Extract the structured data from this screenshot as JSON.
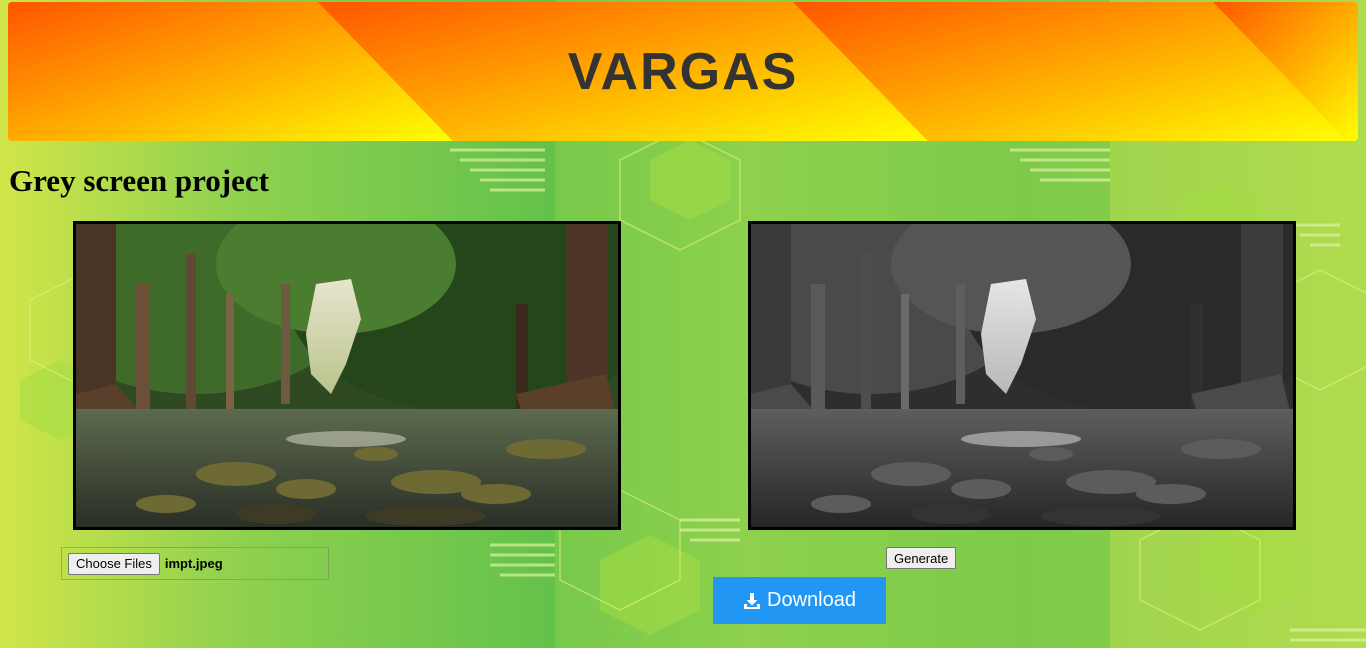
{
  "banner": {
    "title": "VARGAS",
    "colors": {
      "orange": "#ff5500",
      "yellow": "#ffff00"
    }
  },
  "page": {
    "title": "Grey screen project"
  },
  "images": {
    "original": {
      "alt": "",
      "kind": "color-forest-river"
    },
    "grey": {
      "alt": "",
      "kind": "greyscale-forest-river"
    }
  },
  "file_input": {
    "button_label": "Choose Files",
    "file_name": "impt.jpeg"
  },
  "generate": {
    "label": "Generate"
  },
  "download": {
    "label": "Download",
    "icon": "download-icon",
    "color": "#2196f3"
  }
}
